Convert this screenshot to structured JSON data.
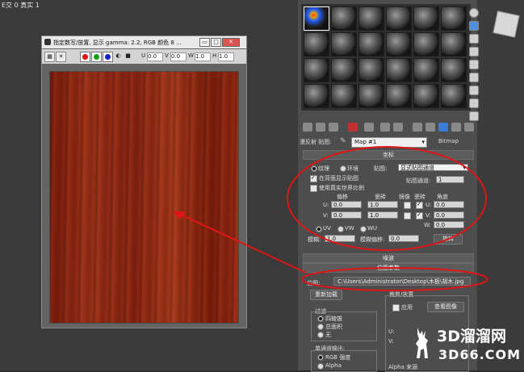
{
  "viewport": {
    "label": "E交 0 真实 1"
  },
  "image_window": {
    "title": "指定数写/放置, 显示 gamma: 2.2, RGB 颜色 8 ...",
    "controls": {
      "minimize": "▭",
      "maximize": "□",
      "close": "✕"
    },
    "toolbar": {
      "u_label": "U",
      "u_value": "0.0",
      "v_label": "V",
      "v_value": "0.0",
      "w_label": "W",
      "w_value": "1.0",
      "h_label": "H",
      "h_value": "1.0"
    }
  },
  "material_editor": {
    "map_label": "漫反射 贴图:",
    "map_name": "Map #1",
    "map_type": "Bitmap",
    "coords": {
      "header": "坐标",
      "texture_label": "纹理",
      "environ_label": "环境",
      "mapping_label": "贴图:",
      "mapping_value": "显式贴图通道",
      "show_back_label": "在背面显示贴图",
      "map_channel_label": "贴图通道:",
      "map_channel_value": "1",
      "real_world_label": "使用真实世界比例",
      "col_offset": "偏移",
      "col_tiling": "瓷砖",
      "col_mirror": "镜像",
      "col_tile": "瓷砖",
      "col_angle": "角度",
      "u_label": "U:",
      "v_label": "V:",
      "w_label": "W:",
      "u_offset": "0.0",
      "v_offset": "0.0",
      "u_tiling": "1.0",
      "v_tiling": "1.0",
      "u_angle": "0.0",
      "v_angle": "0.0",
      "w_angle": "0.0",
      "uv_label": "UV",
      "vw_label": "VW",
      "wu_label": "WU",
      "blur_label": "模糊:",
      "blur_value": "1.0",
      "blur_offset_label": "模糊偏移:",
      "blur_offset_value": "0.0",
      "rotate_label": "旋转"
    },
    "noise_header": "噪波",
    "bitmap_params_header": "位图参数",
    "bitmap_label": "位图:",
    "bitmap_path": "C:\\Users\\Administrator\\Desktop\\木板\\胡木.jpg",
    "reload_label": "重新加载",
    "crop_header": "裁剪/放置",
    "apply_label": "应用",
    "view_image_label": "查看图像",
    "filter_header": "过滤",
    "filter_options": [
      "四棱锥",
      "总面积",
      "无"
    ],
    "mono_header": "单通道输出:",
    "mono_options": [
      "RGB 强度",
      "Alpha"
    ],
    "alpha_source_header": "Alpha 来源",
    "crop_u_label": "U:",
    "crop_v_label": "V:"
  },
  "watermark": {
    "main": "3D溜溜网",
    "sub": "3D66.COM"
  }
}
